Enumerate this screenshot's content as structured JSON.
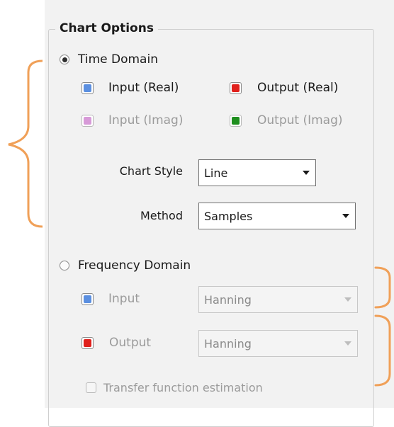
{
  "group": {
    "title": "Chart Options"
  },
  "time_domain": {
    "radio_label": "Time Domain",
    "selected": true,
    "checkboxes": [
      {
        "label": "Input (Real)",
        "color": "#5b8fe0",
        "enabled": true
      },
      {
        "label": "Output (Real)",
        "color": "#e0201c",
        "enabled": true
      },
      {
        "label": "Input (Imag)",
        "color": "#d79ad8",
        "enabled": false
      },
      {
        "label": "Output (Imag)",
        "color": "#1f8f1f",
        "enabled": false
      }
    ],
    "chart_style": {
      "label": "Chart Style",
      "value": "Line"
    },
    "method": {
      "label": "Method",
      "value": "Samples"
    }
  },
  "frequency_domain": {
    "radio_label": "Frequency Domain",
    "selected": false,
    "input": {
      "label": "Input",
      "color": "#5b8fe0",
      "window": "Hanning"
    },
    "output": {
      "label": "Output",
      "color": "#e0201c",
      "window": "Hanning"
    },
    "transfer": {
      "label": "Transfer function estimation",
      "checked": false
    }
  },
  "annotation_color": "#f0a058"
}
